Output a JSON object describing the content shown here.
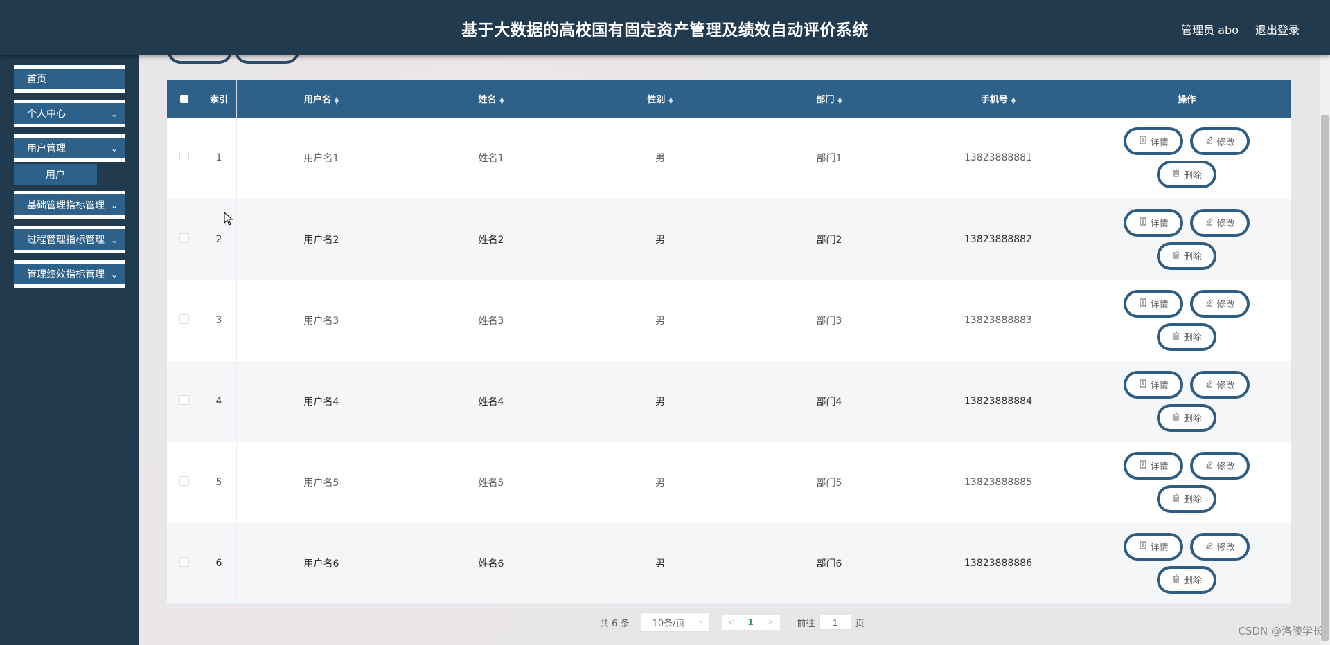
{
  "header": {
    "title": "基于大数据的高校国有固定资产管理及绩效自动评价系统",
    "user_label": "管理员 abo",
    "logout_label": "退出登录"
  },
  "sidebar": {
    "items": [
      {
        "label": "首页"
      },
      {
        "label": "个人中心"
      },
      {
        "label": "用户管理"
      },
      {
        "label": "用户"
      },
      {
        "label": "基础管理指标管理"
      },
      {
        "label": "过程管理指标管理"
      },
      {
        "label": "管理绩效指标管理"
      }
    ]
  },
  "table": {
    "columns": [
      "索引",
      "用户名",
      "姓名",
      "性别",
      "部门",
      "手机号",
      "操作"
    ],
    "rows": [
      {
        "index": "1",
        "username": "用户名1",
        "name": "姓名1",
        "gender": "男",
        "dept": "部门1",
        "phone": "13823888881"
      },
      {
        "index": "2",
        "username": "用户名2",
        "name": "姓名2",
        "gender": "男",
        "dept": "部门2",
        "phone": "13823888882"
      },
      {
        "index": "3",
        "username": "用户名3",
        "name": "姓名3",
        "gender": "男",
        "dept": "部门3",
        "phone": "13823888883"
      },
      {
        "index": "4",
        "username": "用户名4",
        "name": "姓名4",
        "gender": "男",
        "dept": "部门4",
        "phone": "13823888884"
      },
      {
        "index": "5",
        "username": "用户名5",
        "name": "姓名5",
        "gender": "男",
        "dept": "部门5",
        "phone": "13823888885"
      },
      {
        "index": "6",
        "username": "用户名6",
        "name": "姓名6",
        "gender": "男",
        "dept": "部门6",
        "phone": "13823888886"
      }
    ],
    "actions": {
      "detail": "详情",
      "edit": "修改",
      "delete": "删除"
    }
  },
  "pagination": {
    "total": "共 6 条",
    "page_size": "10条/页",
    "current_page": "1",
    "goto_prefix": "前往",
    "goto_value": "1",
    "goto_suffix": "页"
  },
  "watermark": "CSDN @洛陵学长"
}
